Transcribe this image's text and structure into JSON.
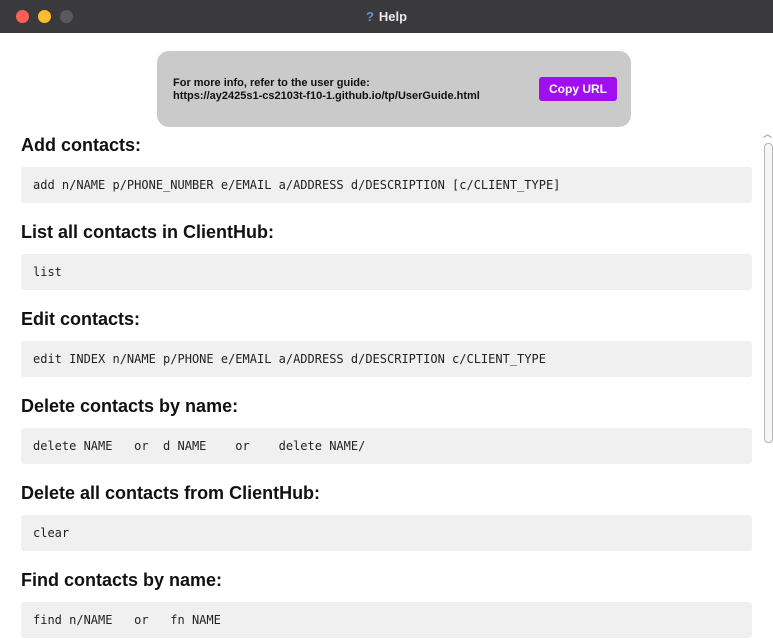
{
  "window": {
    "title": "Help",
    "help_icon_glyph": "?"
  },
  "guide": {
    "line1": "For more info, refer to the user guide:",
    "line2": "https://ay2425s1-cs2103t-f10-1.github.io/tp/UserGuide.html",
    "copy_label": "Copy URL",
    "button_color": "#a10ff0"
  },
  "sections": [
    {
      "heading": "Add contacts:",
      "code": "add n/NAME p/PHONE_NUMBER e/EMAIL a/ADDRESS d/DESCRIPTION [c/CLIENT_TYPE]"
    },
    {
      "heading": "List all contacts in ClientHub:",
      "code": "list"
    },
    {
      "heading": "Edit contacts:",
      "code": "edit INDEX n/NAME p/PHONE e/EMAIL a/ADDRESS d/DESCRIPTION c/CLIENT_TYPE"
    },
    {
      "heading": "Delete contacts by name:",
      "code": "delete NAME   or  d NAME    or    delete NAME/"
    },
    {
      "heading": "Delete all contacts from ClientHub:",
      "code": "clear"
    },
    {
      "heading": "Find contacts by name:",
      "code": "find n/NAME   or   fn NAME"
    }
  ],
  "icons": {
    "close": "close-dot-icon",
    "minimize": "minimize-dot-icon",
    "maximize": "maximize-dot-icon",
    "help": "help-icon",
    "scroll_up": "scroll-up-arrow-icon"
  }
}
